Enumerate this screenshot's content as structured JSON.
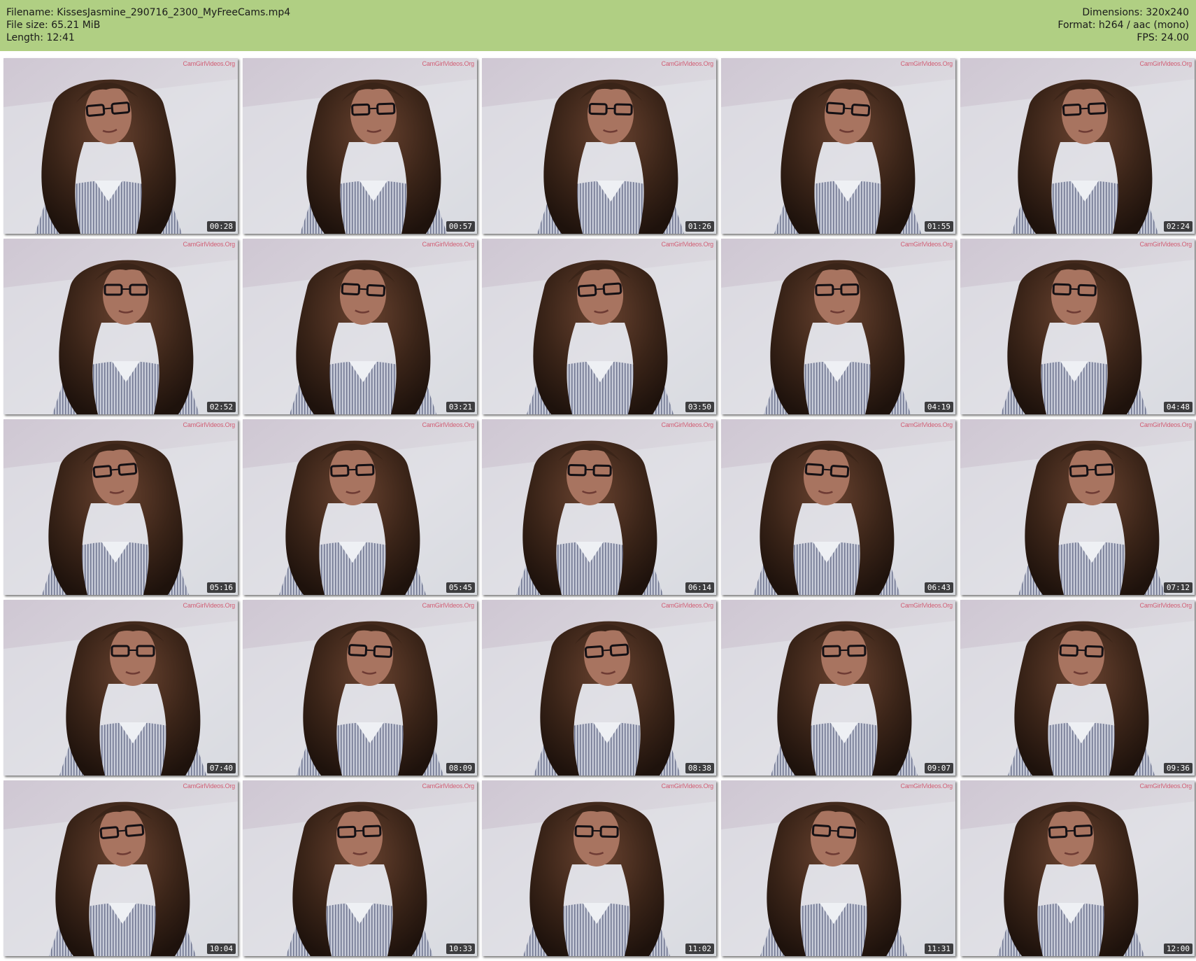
{
  "header": {
    "filename": "Filename: KissesJasmine_290716_2300_MyFreeCams.mp4",
    "file_size": "File size: 65.21 MiB",
    "length": "Length: 12:41",
    "dimensions": "Dimensions: 320x240",
    "format": "Format: h264 / aac (mono)",
    "fps": "FPS: 24.00"
  },
  "colors": {
    "header_bg": "#b0cf83",
    "watermark": "#d04a62"
  },
  "watermark_text": "CamGirlVideos.Org",
  "thumbnails": [
    {
      "time": "00:28"
    },
    {
      "time": "00:57"
    },
    {
      "time": "01:26"
    },
    {
      "time": "01:55"
    },
    {
      "time": "02:24"
    },
    {
      "time": "02:52"
    },
    {
      "time": "03:21"
    },
    {
      "time": "03:50"
    },
    {
      "time": "04:19"
    },
    {
      "time": "04:48"
    },
    {
      "time": "05:16"
    },
    {
      "time": "05:45"
    },
    {
      "time": "06:14"
    },
    {
      "time": "06:43"
    },
    {
      "time": "07:12"
    },
    {
      "time": "07:40"
    },
    {
      "time": "08:09"
    },
    {
      "time": "08:38"
    },
    {
      "time": "09:07"
    },
    {
      "time": "09:36"
    },
    {
      "time": "10:04"
    },
    {
      "time": "10:33"
    },
    {
      "time": "11:02"
    },
    {
      "time": "11:31"
    },
    {
      "time": "12:00"
    }
  ]
}
